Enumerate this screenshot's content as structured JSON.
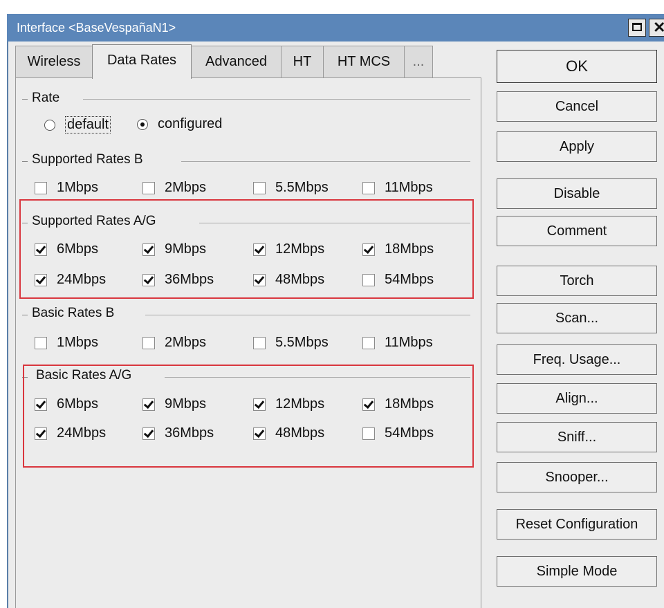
{
  "window": {
    "title": "Interface <BaseVespañaN1>",
    "maximize_icon": "maximize-icon",
    "close_icon": "close-icon",
    "close_glyph": "✕"
  },
  "tabs": [
    {
      "label": "Wireless",
      "active": false
    },
    {
      "label": "Data Rates",
      "active": true
    },
    {
      "label": "Advanced",
      "active": false
    },
    {
      "label": "HT",
      "active": false
    },
    {
      "label": "HT MCS",
      "active": false
    },
    {
      "label": "...",
      "active": false
    }
  ],
  "rate": {
    "heading": "Rate",
    "options": [
      {
        "label": "default",
        "selected": false
      },
      {
        "label": "configured",
        "selected": true
      }
    ]
  },
  "supported_b": {
    "heading": "Supported Rates B",
    "rates": [
      {
        "label": "1Mbps",
        "checked": false
      },
      {
        "label": "2Mbps",
        "checked": false
      },
      {
        "label": "5.5Mbps",
        "checked": false
      },
      {
        "label": "11Mbps",
        "checked": false
      }
    ]
  },
  "supported_ag": {
    "heading": "Supported Rates A/G",
    "rates": [
      {
        "label": "6Mbps",
        "checked": true
      },
      {
        "label": "9Mbps",
        "checked": true
      },
      {
        "label": "12Mbps",
        "checked": true
      },
      {
        "label": "18Mbps",
        "checked": true
      },
      {
        "label": "24Mbps",
        "checked": true
      },
      {
        "label": "36Mbps",
        "checked": true
      },
      {
        "label": "48Mbps",
        "checked": true
      },
      {
        "label": "54Mbps",
        "checked": false
      }
    ]
  },
  "basic_b": {
    "heading": "Basic Rates B",
    "rates": [
      {
        "label": "1Mbps",
        "checked": false
      },
      {
        "label": "2Mbps",
        "checked": false
      },
      {
        "label": "5.5Mbps",
        "checked": false
      },
      {
        "label": "11Mbps",
        "checked": false
      }
    ]
  },
  "basic_ag": {
    "heading": "Basic Rates A/G",
    "rates": [
      {
        "label": "6Mbps",
        "checked": true
      },
      {
        "label": "9Mbps",
        "checked": true
      },
      {
        "label": "12Mbps",
        "checked": true
      },
      {
        "label": "18Mbps",
        "checked": true
      },
      {
        "label": "24Mbps",
        "checked": true
      },
      {
        "label": "36Mbps",
        "checked": true
      },
      {
        "label": "48Mbps",
        "checked": true
      },
      {
        "label": "54Mbps",
        "checked": false
      }
    ]
  },
  "buttons": {
    "ok": "OK",
    "cancel": "Cancel",
    "apply": "Apply",
    "disable": "Disable",
    "comment": "Comment",
    "torch": "Torch",
    "scan": "Scan...",
    "freq_usage": "Freq. Usage...",
    "align": "Align...",
    "sniff": "Sniff...",
    "snooper": "Snooper...",
    "reset_configuration": "Reset Configuration",
    "simple_mode": "Simple Mode"
  },
  "colors": {
    "titlebar": "#5b86b9",
    "highlight": "#d9363e",
    "panel": "#ececec"
  }
}
